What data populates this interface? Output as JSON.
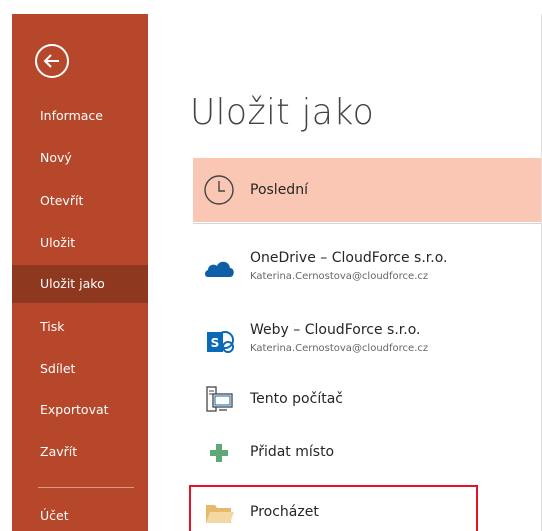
{
  "sidebar": {
    "background": "#b7472a",
    "active_background": "#8e3820",
    "back_icon": "back-arrow-icon",
    "items": [
      {
        "label": "Informace"
      },
      {
        "label": "Nový"
      },
      {
        "label": "Otevřít"
      },
      {
        "label": "Uložit"
      },
      {
        "label": "Uložit jako",
        "active": true
      },
      {
        "label": "Tisk"
      },
      {
        "label": "Sdílet"
      },
      {
        "label": "Exportovat"
      },
      {
        "label": "Zavřít"
      },
      {
        "label": "Účet"
      }
    ]
  },
  "main": {
    "title": "Uložit jako",
    "locations": [
      {
        "icon": "clock-icon",
        "title": "Poslední",
        "subtitle": "",
        "highlighted": true
      },
      {
        "icon": "onedrive-cloud-icon",
        "title": "OneDrive – CloudForce s.r.o.",
        "subtitle": "Katerina.Cernostova@cloudforce.cz"
      },
      {
        "icon": "sharepoint-icon",
        "title": "Weby – CloudForce s.r.o.",
        "subtitle": "Katerina.Cernostova@cloudforce.cz"
      },
      {
        "icon": "computer-icon",
        "title": "Tento počítač",
        "subtitle": ""
      },
      {
        "icon": "plus-icon",
        "title": "Přidat místo",
        "subtitle": ""
      },
      {
        "icon": "folder-icon",
        "title": "Procházet",
        "subtitle": "",
        "outlined": true
      }
    ]
  },
  "colors": {
    "accent": "#b7472a",
    "highlight": "#f9c7b3",
    "outline": "#e81123",
    "onedrive": "#0f5ea8",
    "sharepoint": "#0a6ab8",
    "plus": "#5fa878",
    "folder": "#f4d8a4"
  }
}
